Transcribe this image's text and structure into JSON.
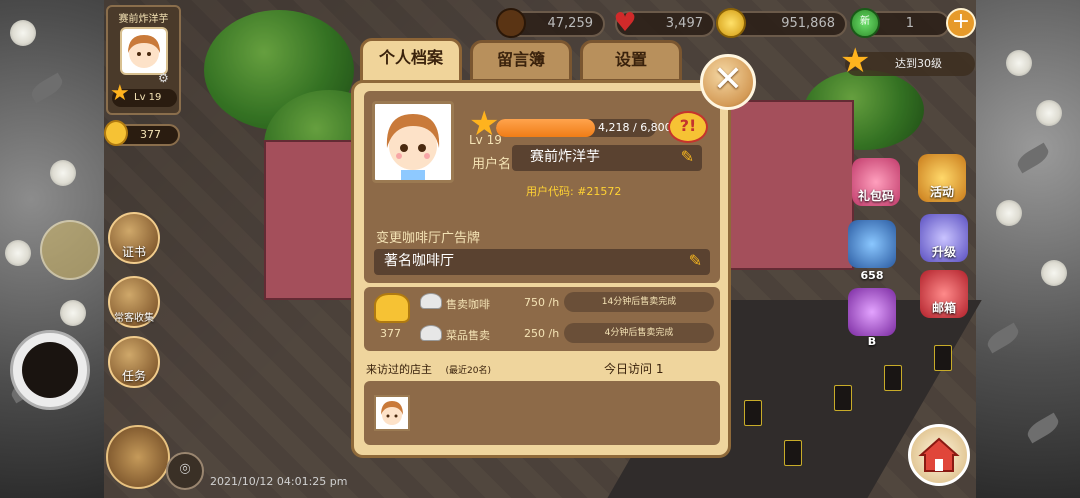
{
  "hud": {
    "coffee_beans": "47,259",
    "hearts": "3,497",
    "coins": "951,868",
    "gems": "1",
    "gem_badge": "新",
    "level_tag": "达到30级"
  },
  "profile_card": {
    "name": "赛前炸洋芋",
    "level": "Lv 19",
    "gold": "377"
  },
  "left_buttons": {
    "certificate": "证书",
    "regulars": "常客收集",
    "tasks": "任务"
  },
  "right_buttons": {
    "gift_code": "礼包码",
    "events": "活动",
    "shop_count": "658",
    "badge_b": "B",
    "mailbox": "邮箱",
    "upgrade": "升级"
  },
  "dialog": {
    "tabs": [
      "个人档案",
      "留言簿",
      "设置"
    ],
    "close_label": "✕",
    "xp_text": "4,218 / 6,800",
    "xp_fraction": 0.62,
    "level": "Lv 19",
    "username_label": "用户名",
    "username_value": "赛前炸洋芋",
    "user_code": "用户代码: #21572",
    "ad_label": "变更咖啡厅广告牌",
    "ad_value": "著名咖啡厅",
    "gold_count": "377",
    "coffee_label": "售卖咖啡",
    "coffee_rate": "750 /h",
    "coffee_status": "14分钟后售卖完成",
    "dessert_label": "菜品售卖",
    "dessert_rate": "250 /h",
    "dessert_status": "4分钟后售卖完成",
    "visitors_label": "来访过的店主",
    "visitors_note": "(最近20名)",
    "today_visits": "今日访问 1"
  },
  "timestamp": "2021/10/12 04:01:25 pm"
}
